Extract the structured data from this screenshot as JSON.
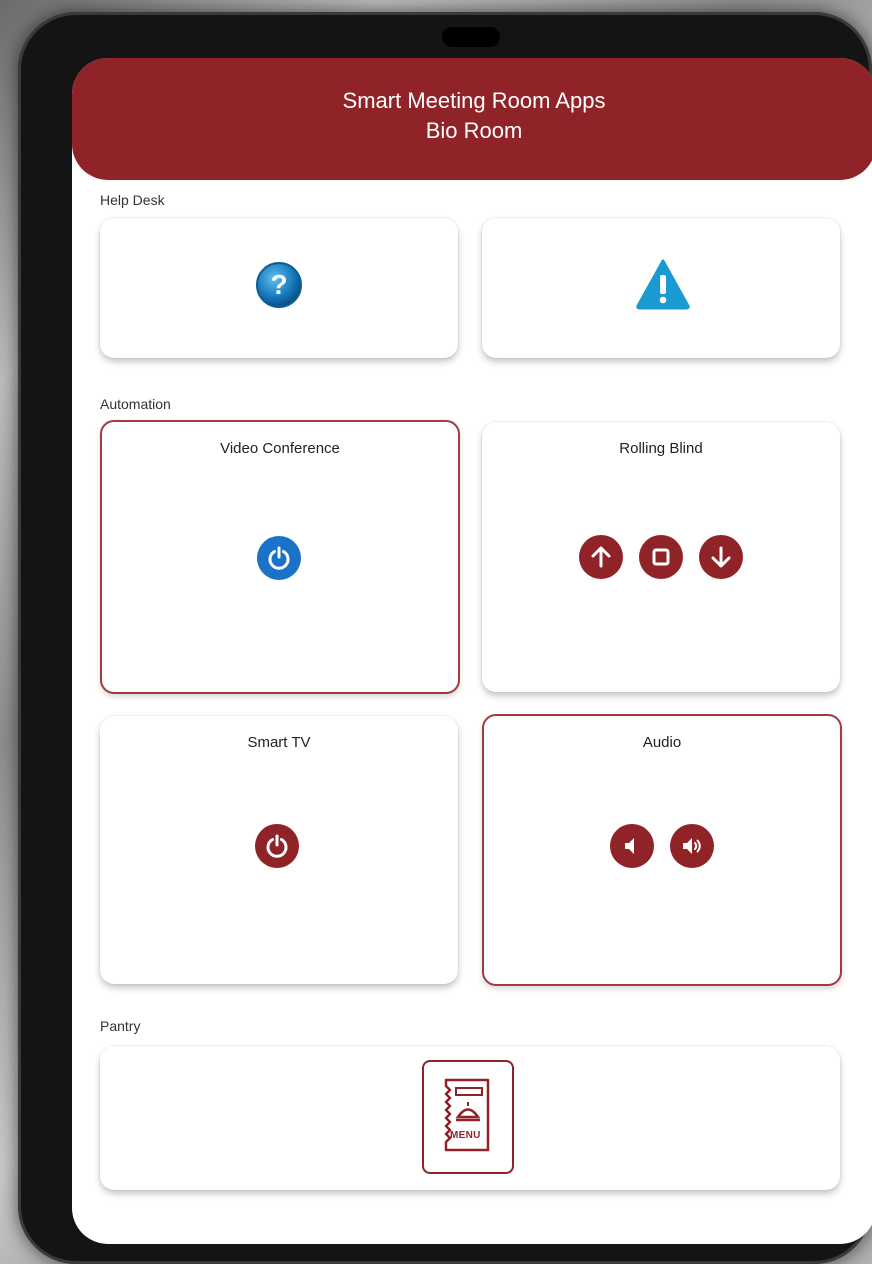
{
  "header": {
    "title": "Smart Meeting Room Apps",
    "subtitle": "Bio Room"
  },
  "sections": {
    "help_desk": "Help Desk",
    "automation": "Automation",
    "pantry": "Pantry"
  },
  "help_desk": {
    "help_icon": "question-icon",
    "alert_icon": "warning-icon"
  },
  "automation": {
    "video_conference": {
      "title": "Video Conference",
      "icon": "power-icon",
      "color": "#1a73c9"
    },
    "rolling_blind": {
      "title": "Rolling Blind",
      "icons": [
        "arrow-up-icon",
        "stop-icon",
        "arrow-down-icon"
      ]
    },
    "smart_tv": {
      "title": "Smart TV",
      "icon": "power-icon"
    },
    "audio": {
      "title": "Audio",
      "icons": [
        "volume-down-icon",
        "volume-up-icon"
      ]
    }
  },
  "pantry": {
    "menu_label": "MENU",
    "icon": "menu-icon"
  },
  "colors": {
    "accent": "#8f2328",
    "blue": "#1a73c9",
    "warning": "#1a9ad0"
  }
}
